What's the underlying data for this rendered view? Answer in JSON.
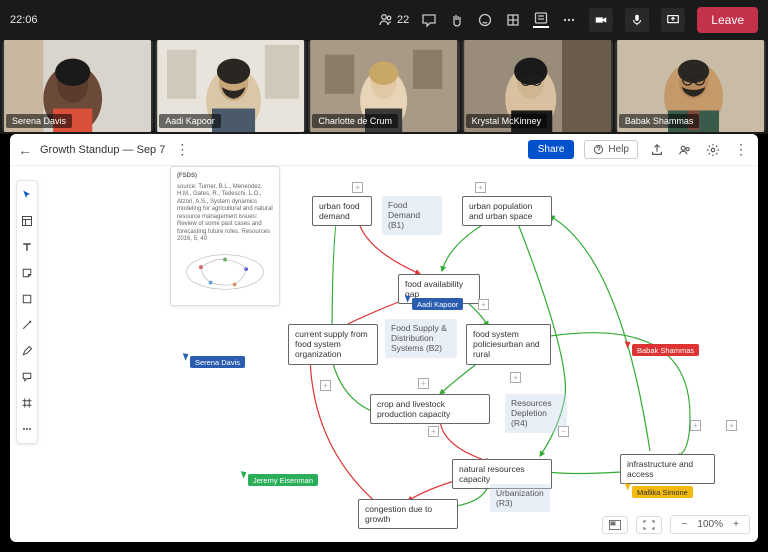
{
  "time": "22:06",
  "participant_count": "22",
  "leave_label": "Leave",
  "participants": [
    {
      "name": "Serena Davis"
    },
    {
      "name": "Aadi Kapoor"
    },
    {
      "name": "Charlotte de Crum"
    },
    {
      "name": "Krystal McKinney"
    },
    {
      "name": "Babak Shammas"
    }
  ],
  "board": {
    "title": "Growth Standup — Sep 7",
    "share": "Share",
    "help": "Help",
    "zoom": "100%"
  },
  "ref": {
    "head": "(FSDS)",
    "body": "source: Turner, B.L., Menendez, H.M., Gates, R., Tedeschi, L.O., Atzori, A.S., System dynamics modeling for agricultural and natural resource management issues: Review of some past cases and forecasting future roles. Resources 2016, 5, 40"
  },
  "nodes": {
    "urbanfood": "urban food demand",
    "fooddemand": "Food Demand (B1)",
    "urbanpop": "urban population and urban space",
    "foodgap": "food availability gap",
    "curr": "current supply from food system organization",
    "supply": "Food Supply & Distribution Systems (B2)",
    "policies": "food system policies",
    "policies_sub": "urban and rural",
    "crop": "crop and livestock production capacity",
    "depl": "Resources Depletion (R4)",
    "nat": "natural resources capacity",
    "urb": "Urbanization (R3)",
    "infra": "infrastructure and access",
    "cong": "congestion due to growth"
  },
  "cursors": {
    "serena": "Serena Davis",
    "aadi": "Aadi Kapoor",
    "babak": "Babak Shammas",
    "jeremy": "Jeremy Eisenman",
    "mallika": "Mallika Simone"
  }
}
